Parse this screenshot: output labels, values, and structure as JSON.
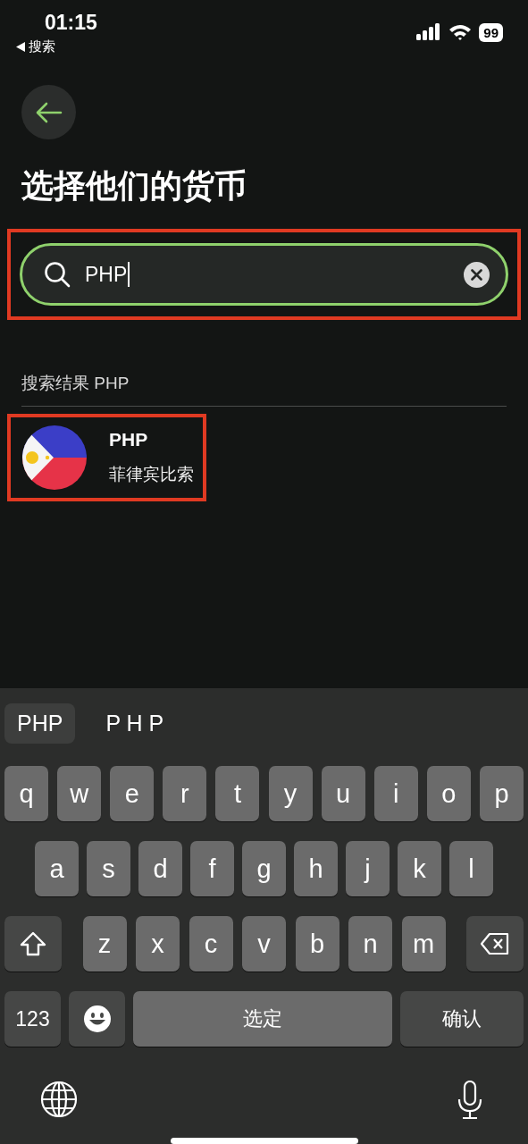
{
  "status_bar": {
    "time": "01:15",
    "back_label": "搜索",
    "battery": "99"
  },
  "title": "选择他们的货币",
  "search": {
    "value": "PHP",
    "focused": true,
    "highlighted": true
  },
  "results": {
    "label": "搜索结果 PHP",
    "items": [
      {
        "code": "PHP",
        "name": "菲律宾比索",
        "highlighted": true
      }
    ]
  },
  "keyboard": {
    "suggestions": [
      {
        "text": "PHP",
        "selected": true
      },
      {
        "text": "P H P",
        "selected": false
      }
    ],
    "rows": [
      [
        {
          "kind": "letter",
          "label": "q"
        },
        {
          "kind": "letter",
          "label": "w"
        },
        {
          "kind": "letter",
          "label": "e"
        },
        {
          "kind": "letter",
          "label": "r"
        },
        {
          "kind": "letter",
          "label": "t"
        },
        {
          "kind": "letter",
          "label": "y"
        },
        {
          "kind": "letter",
          "label": "u"
        },
        {
          "kind": "letter",
          "label": "i"
        },
        {
          "kind": "letter",
          "label": "o"
        },
        {
          "kind": "letter",
          "label": "p"
        }
      ],
      [
        {
          "kind": "letter",
          "label": "a"
        },
        {
          "kind": "letter",
          "label": "s"
        },
        {
          "kind": "letter",
          "label": "d"
        },
        {
          "kind": "letter",
          "label": "f"
        },
        {
          "kind": "letter",
          "label": "g"
        },
        {
          "kind": "letter",
          "label": "h"
        },
        {
          "kind": "letter",
          "label": "j"
        },
        {
          "kind": "letter",
          "label": "k"
        },
        {
          "kind": "letter",
          "label": "l"
        }
      ],
      [
        {
          "kind": "shift"
        },
        {
          "kind": "letter",
          "label": "z"
        },
        {
          "kind": "letter",
          "label": "x"
        },
        {
          "kind": "letter",
          "label": "c"
        },
        {
          "kind": "letter",
          "label": "v"
        },
        {
          "kind": "letter",
          "label": "b"
        },
        {
          "kind": "letter",
          "label": "n"
        },
        {
          "kind": "letter",
          "label": "m"
        },
        {
          "kind": "delete"
        }
      ]
    ],
    "bottom_row": {
      "number_key": "123",
      "space_key": "选定",
      "return_key": "确认"
    }
  }
}
